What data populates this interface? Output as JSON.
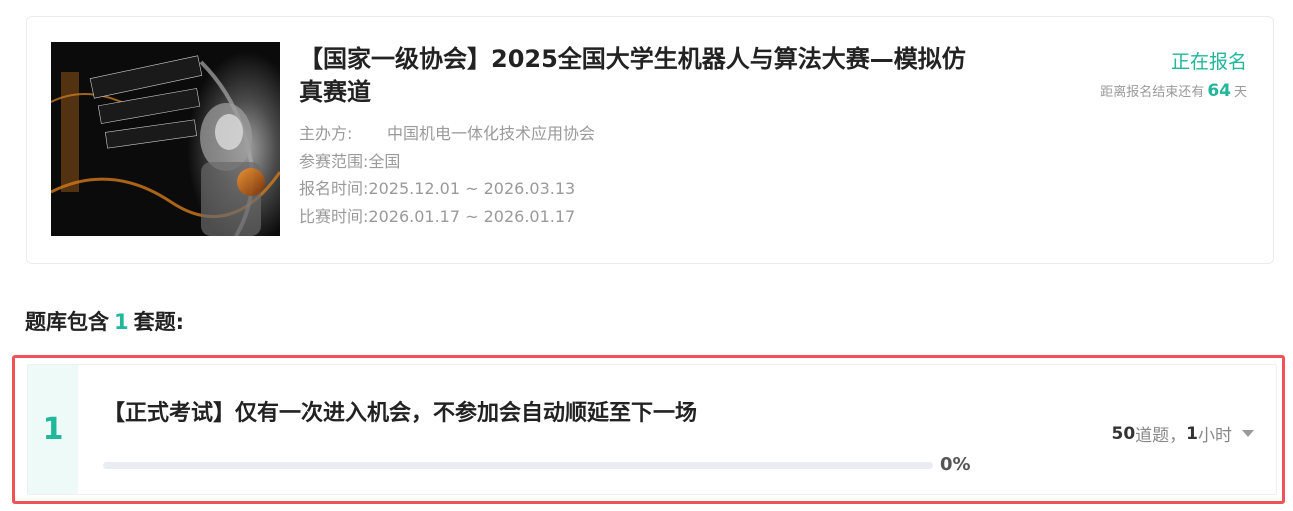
{
  "competition": {
    "title": "【国家一级协会】2025全国大学生机器人与算法大赛—模拟仿真赛道",
    "status": "正在报名",
    "countdown_prefix": "距离报名结束还有",
    "countdown_days": "64",
    "countdown_suffix": "天",
    "organizer_label": "主办方:",
    "organizer": "中国机电一体化技术应用协会",
    "scope_label": "参赛范围:",
    "scope": "全国",
    "signup_label": "报名时间:",
    "signup_time": "2025.12.01 ~ 2026.03.13",
    "contest_label": "比赛时间:",
    "contest_time": "2026.01.17 ~ 2026.01.17",
    "colors": {
      "accent": "#21b79a",
      "highlight_border": "#ef5257"
    }
  },
  "question_bank": {
    "prefix": "题库包含",
    "count": "1",
    "suffix": "套题:",
    "sets": [
      {
        "index": "1",
        "title": "【正式考试】仅有一次进入机会，不参加会自动顺延至下一场",
        "progress_percent": 0,
        "progress_text": "0%",
        "question_count": "50",
        "question_unit": "道题，",
        "duration": "1",
        "duration_unit": "小时",
        "expand_icon": "caret-down-icon"
      }
    ]
  }
}
